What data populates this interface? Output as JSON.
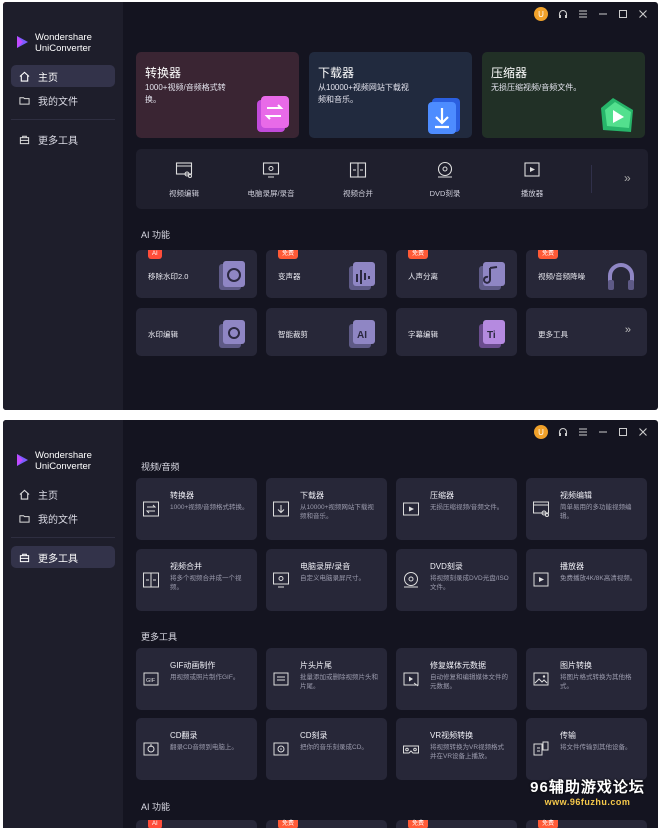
{
  "app": {
    "logo_text_line1": "Wondershare",
    "logo_text_line2": "UniConverter",
    "avatar_initial": "U"
  },
  "nav": {
    "home": "主页",
    "my_files": "我的文件",
    "more_tools": "更多工具"
  },
  "hero": [
    {
      "title": "转换器",
      "desc": "1000+视频/音频格式转换。",
      "color": "#3a2533"
    },
    {
      "title": "下载器",
      "desc": "从10000+视频网站下载视频和音乐。",
      "color": "#212a3e"
    },
    {
      "title": "压缩器",
      "desc": "无损压缩视频/音频文件。",
      "color": "#213026"
    }
  ],
  "toolbar": [
    {
      "label": "视频编辑",
      "icon": "video-edit-icon"
    },
    {
      "label": "电脑录屏/录音",
      "icon": "screen-record-icon"
    },
    {
      "label": "视频合并",
      "icon": "merge-icon"
    },
    {
      "label": "DVD刻录",
      "icon": "dvd-icon"
    },
    {
      "label": "播放器",
      "icon": "player-icon"
    }
  ],
  "ai_section_title": "AI 功能",
  "ai_cards": [
    {
      "label": "移除水印2.0",
      "badge": "AI"
    },
    {
      "label": "变声器",
      "badge": "免费"
    },
    {
      "label": "人声分离",
      "badge": "免费"
    },
    {
      "label": "视频/音频降噪",
      "badge": "免费"
    },
    {
      "label": "水印编辑",
      "badge": ""
    },
    {
      "label": "智能裁剪",
      "badge": ""
    },
    {
      "label": "字幕编辑",
      "badge": ""
    },
    {
      "label": "更多工具",
      "badge": ""
    }
  ],
  "more_page": {
    "section_video_audio": "视频/音频",
    "section_more_tools": "更多工具",
    "section_ai": "AI 功能",
    "video_audio_tiles": [
      {
        "title": "转换器",
        "desc": "1000+视频/音频格式转换。"
      },
      {
        "title": "下载器",
        "desc": "从10000+视频网站下载视频和音乐。"
      },
      {
        "title": "压缩器",
        "desc": "无损压缩视频/音频文件。"
      },
      {
        "title": "视频编辑",
        "desc": "简单易用的多功能视频编辑。"
      },
      {
        "title": "视频合并",
        "desc": "将多个视频合并成一个视频。"
      },
      {
        "title": "电脑录屏/录音",
        "desc": "自定义电脑录屏尺寸。"
      },
      {
        "title": "DVD刻录",
        "desc": "将视频刻录成DVD光盘/ISO文件。"
      },
      {
        "title": "播放器",
        "desc": "免费播放4K/8K高清视频。"
      }
    ],
    "more_tools_tiles": [
      {
        "title": "GIF动画制作",
        "desc": "用视频或照片制作GIF。"
      },
      {
        "title": "片头片尾",
        "desc": "批量添加或删除视频片头和片尾。"
      },
      {
        "title": "修复媒体元数据",
        "desc": "自动修复和编辑媒体文件的元数据。"
      },
      {
        "title": "图片转换",
        "desc": "将图片格式转换为其他格式。"
      },
      {
        "title": "CD翻录",
        "desc": "翻录CD音频到电脑上。"
      },
      {
        "title": "CD刻录",
        "desc": "把你的音乐刻录成CD。"
      },
      {
        "title": "VR视频转换",
        "desc": "将视频转换为VR视频格式并在VR设备上播放。"
      },
      {
        "title": "传输",
        "desc": "将文件传输到其他设备。"
      }
    ],
    "ai_badges": [
      "AI",
      "免费",
      "免费",
      "免费"
    ]
  },
  "watermark": {
    "line1": "96辅助游戏论坛",
    "line2": "www.96fuzhu.com"
  }
}
